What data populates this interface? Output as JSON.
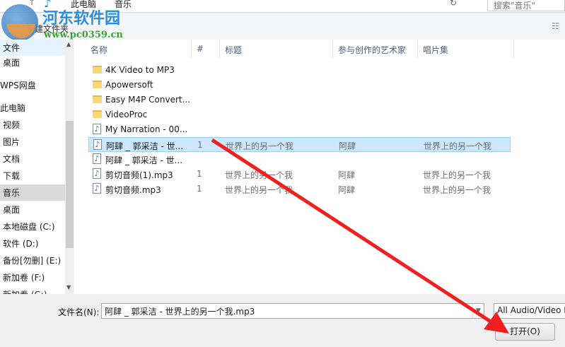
{
  "address": {
    "crumbs": [
      "此电脑",
      "音乐"
    ],
    "search_placeholder": "搜索\"音乐\""
  },
  "toolbar": {
    "new_folder": "新建文件夹"
  },
  "watermark": {
    "name": "河东软件园",
    "url": "www.pc0359.cn"
  },
  "sidebar": [
    "文件",
    "桌面",
    "WPS网盘",
    "此电脑",
    "视频",
    "图片",
    "文档",
    "下载",
    "音乐",
    "桌面",
    "本地磁盘 (C:)",
    "软件 (D:)",
    "备份[勿删] (E:)",
    "新加卷 (F:)",
    "新加卷 (G:)"
  ],
  "columns": [
    "名称",
    "#",
    "标题",
    "参与创作的艺术家",
    "唱片集"
  ],
  "files": [
    {
      "name": "4K Video to MP3",
      "type": "folder",
      "num": "",
      "title": "",
      "artist": "",
      "album": ""
    },
    {
      "name": "Apowersoft",
      "type": "folder",
      "num": "",
      "title": "",
      "artist": "",
      "album": ""
    },
    {
      "name": "Easy M4P Convert...",
      "type": "folder",
      "num": "",
      "title": "",
      "artist": "",
      "album": ""
    },
    {
      "name": "VideoProc",
      "type": "folder",
      "num": "",
      "title": "",
      "artist": "",
      "album": ""
    },
    {
      "name": "My Narration - 00...",
      "type": "audio",
      "num": "",
      "title": "",
      "artist": "",
      "album": ""
    },
    {
      "name": "阿肆 _ 郭采洁 - 世...",
      "type": "audio",
      "num": "1",
      "title": "世界上的另一个我",
      "artist": "阿肆",
      "album": "世界上的另一个我",
      "selected": true
    },
    {
      "name": "阿肆 _ 郭采洁 - 世...",
      "type": "audio",
      "num": "",
      "title": "",
      "artist": "",
      "album": ""
    },
    {
      "name": "剪切音频(1).mp3",
      "type": "audio",
      "num": "1",
      "title": "世界上的另一个我",
      "artist": "阿肆",
      "album": "世界上的另一个我"
    },
    {
      "name": "剪切音频.mp3",
      "type": "audio",
      "num": "1",
      "title": "世界上的另一个我",
      "artist": "阿肆",
      "album": "世界上的另一个我"
    }
  ],
  "footer": {
    "filename_label": "文件名(N):",
    "filename_value": "阿肆 _ 郭采洁 - 世界上的另一个我.mp3",
    "filter": "All Audio/Video Files",
    "open": "打开(O)"
  },
  "colors": {
    "selection": "#cce8ff",
    "arrow": "#f02020"
  }
}
